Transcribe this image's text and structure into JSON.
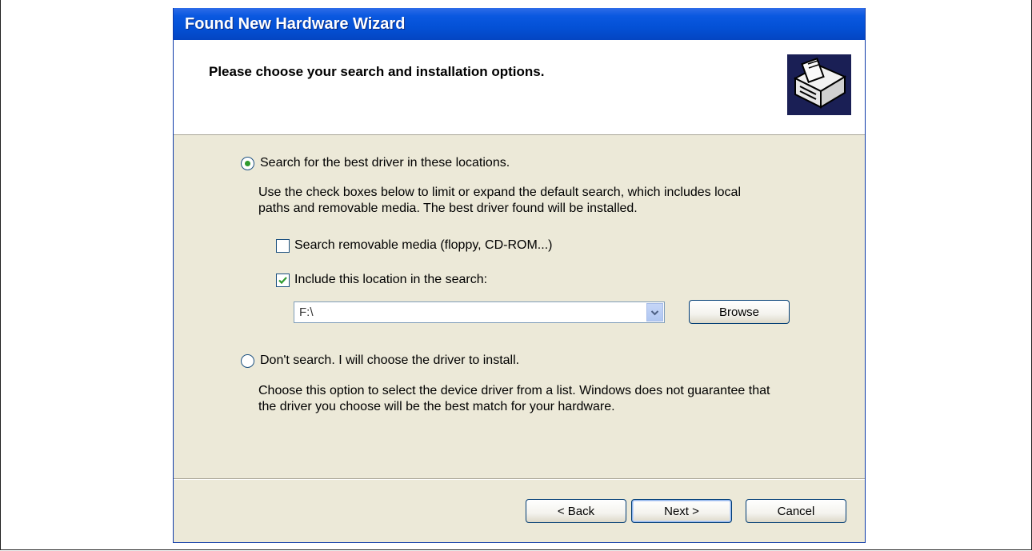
{
  "window": {
    "title": "Found New Hardware Wizard"
  },
  "header": {
    "title": "Please choose your search and installation options.",
    "icon": "hardware-icon"
  },
  "option_search": {
    "label": "Search for the best driver in these locations.",
    "selected": true,
    "description_line1": "Use the check boxes below to limit or expand the default search, which includes local",
    "description_line2": "paths and removable media. The best driver found will be installed.",
    "removable_media": {
      "label": "Search removable media (floppy, CD-ROM...)",
      "checked": false
    },
    "include_location": {
      "label": "Include this location in the search:",
      "checked": true
    },
    "location_value": "F:\\",
    "browse_label": "Browse"
  },
  "option_manual": {
    "label": "Don't search. I will choose the driver to install.",
    "selected": false,
    "description_line1": "Choose this option to select the device driver from a list.  Windows does not guarantee that",
    "description_line2": "the driver you choose will be the best match for your hardware."
  },
  "footer": {
    "back_label": "< Back",
    "next_label": "Next >",
    "cancel_label": "Cancel"
  },
  "colors": {
    "titlebar": "#0451d6",
    "dialog_bg": "#ece9d8",
    "radio_dot": "#2e9a2e",
    "check_mark": "#2e9a2e"
  }
}
